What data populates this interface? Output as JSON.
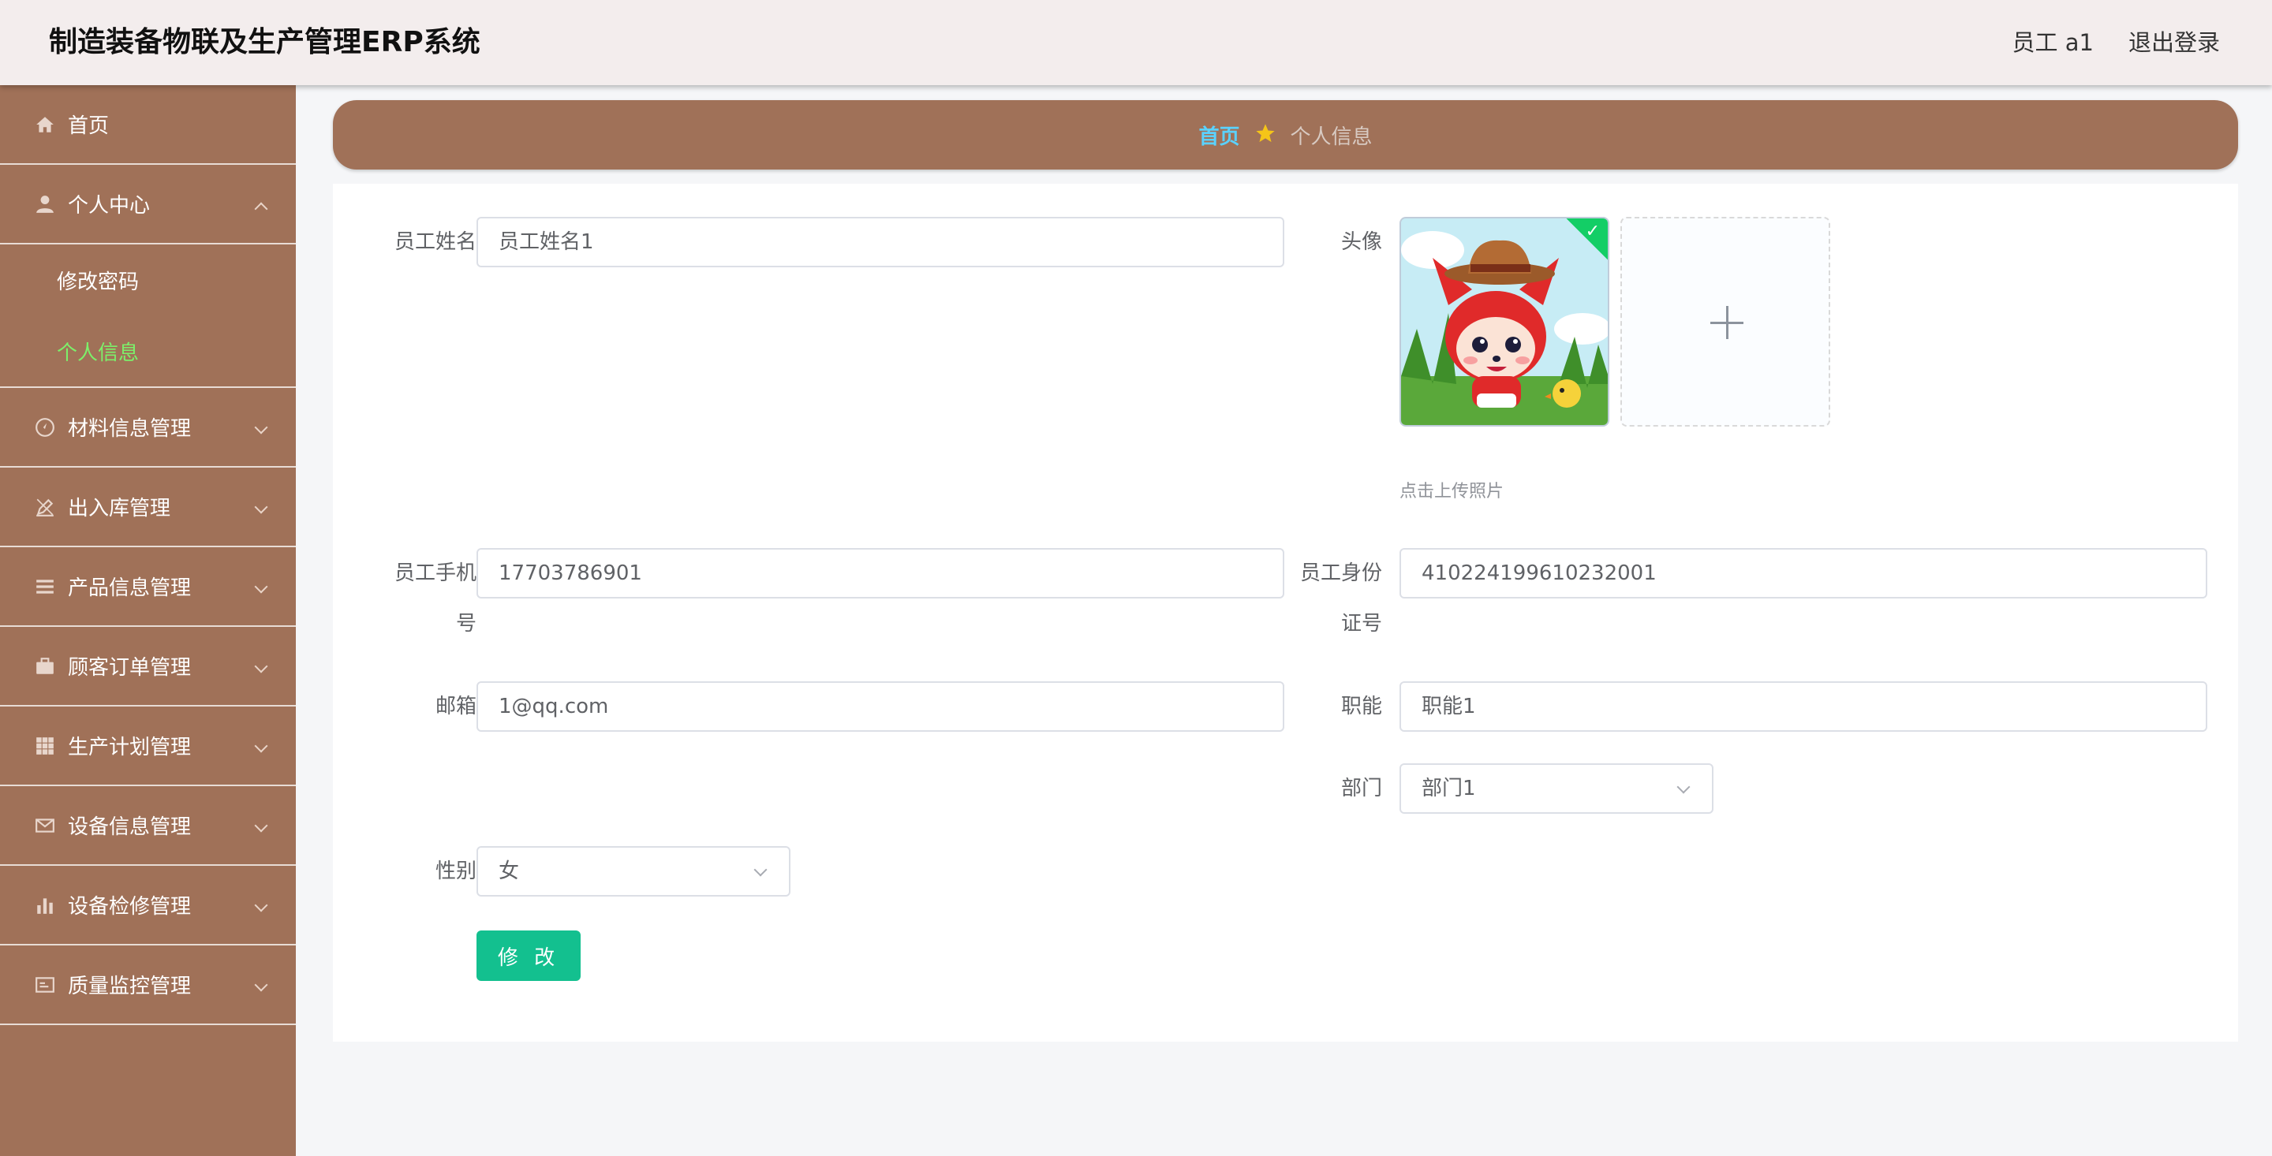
{
  "header": {
    "title": "制造装备物联及生产管理ERP系统",
    "user": "员工 a1",
    "logout": "退出登录"
  },
  "sidebar": {
    "items": [
      {
        "label": "首页",
        "icon": "home-icon"
      },
      {
        "label": "个人中心",
        "icon": "user-icon",
        "expanded": true,
        "children": [
          "修改密码",
          "个人信息"
        ],
        "active_child": "个人信息"
      },
      {
        "label": "材料信息管理",
        "icon": "compass-icon"
      },
      {
        "label": "出入库管理",
        "icon": "edit-icon"
      },
      {
        "label": "产品信息管理",
        "icon": "list-icon"
      },
      {
        "label": "顾客订单管理",
        "icon": "briefcase-icon"
      },
      {
        "label": "生产计划管理",
        "icon": "grid-icon"
      },
      {
        "label": "设备信息管理",
        "icon": "mail-icon"
      },
      {
        "label": "设备检修管理",
        "icon": "bar-chart-icon"
      },
      {
        "label": "质量监控管理",
        "icon": "monitor-icon"
      }
    ]
  },
  "breadcrumb": {
    "home": "首页",
    "current": "个人信息"
  },
  "form": {
    "name_label": "员工姓名",
    "name_value": "员工姓名1",
    "avatar_label": "头像",
    "upload_tip": "点击上传照片",
    "phone_label_1": "员工手机",
    "phone_label_2": "号",
    "phone_value": "17703786901",
    "idcard_label_1": "员工身份",
    "idcard_label_2": "证号",
    "idcard_value": "410224199610232001",
    "email_label": "邮箱",
    "email_value": "1@qq.com",
    "role_label": "职能",
    "role_value": "职能1",
    "dept_label": "部门",
    "dept_value": "部门1",
    "gender_label": "性别",
    "gender_value": "女",
    "submit": "修 改"
  },
  "colors": {
    "sidebar_bg": "#a07158",
    "header_bg": "#f3eded",
    "active_menu": "#7cf06a",
    "crumb_home": "#5ad2ff",
    "button": "#13c08f"
  }
}
